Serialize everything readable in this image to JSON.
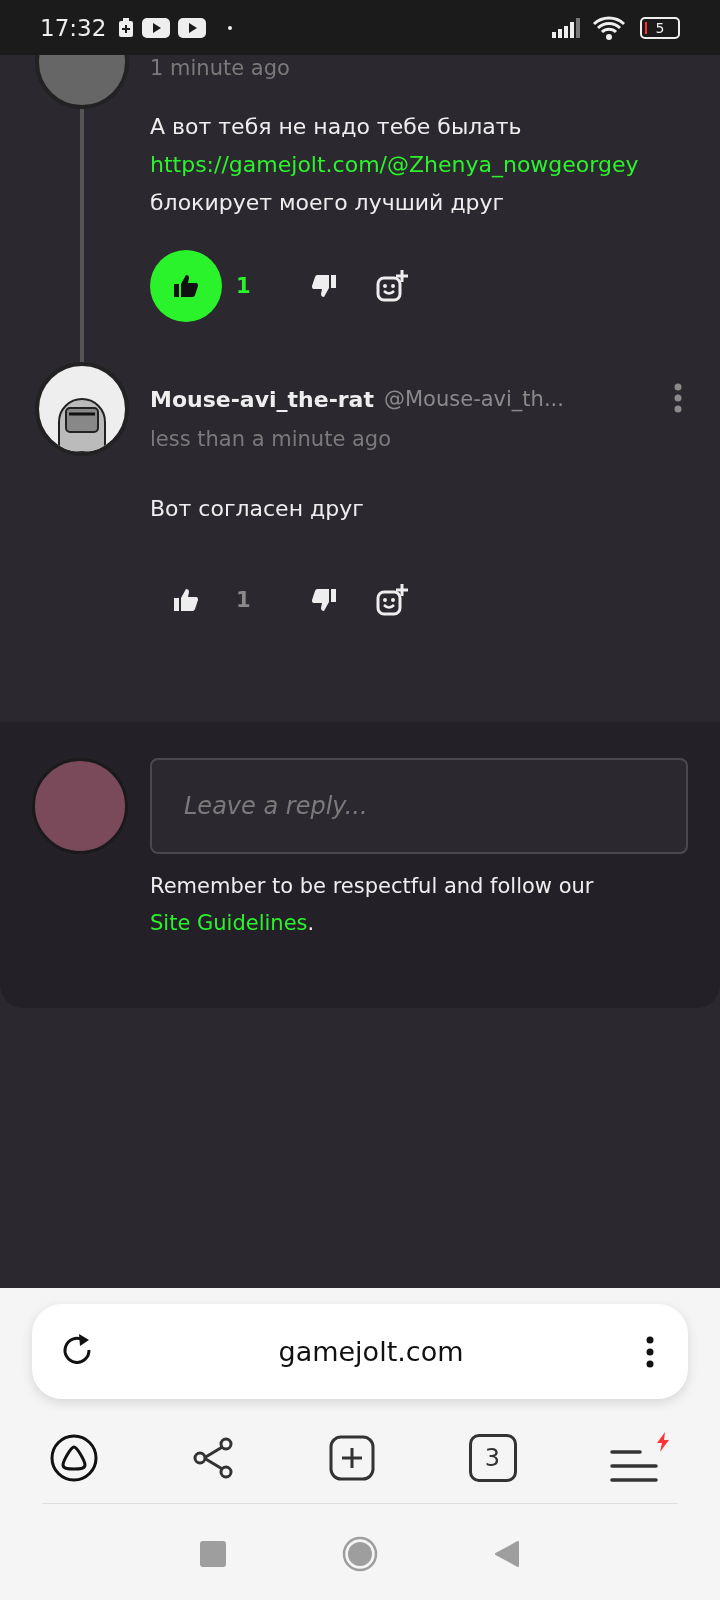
{
  "status_bar": {
    "time": "17:32",
    "battery": "5"
  },
  "comments": [
    {
      "time": "1 minute ago",
      "parts": [
        {
          "kind": "text",
          "text": "А вот тебя не надо тебе былать"
        },
        {
          "kind": "link",
          "text": "https://gamejolt.com/@Zhenya_nowgeorgey"
        },
        {
          "kind": "text",
          "text": "блокирует моего лучший друг"
        }
      ],
      "liked": true,
      "likes": "1",
      "threaded": true
    },
    {
      "name": "Mouse-avi_the-rat",
      "handle": "@Mouse-avi_th...",
      "time": "less than a minute ago",
      "parts": [
        {
          "kind": "text",
          "text": "Вот согласен друг"
        }
      ],
      "liked": false,
      "likes": "1",
      "threaded": false
    }
  ],
  "reply": {
    "placeholder": "Leave a reply...",
    "note": "Remember to be respectful and follow our",
    "link": "Site Guidelines",
    "after": "."
  },
  "browser": {
    "url": "gamejolt.com",
    "tabs_count": "3",
    "menu_alert": true
  }
}
